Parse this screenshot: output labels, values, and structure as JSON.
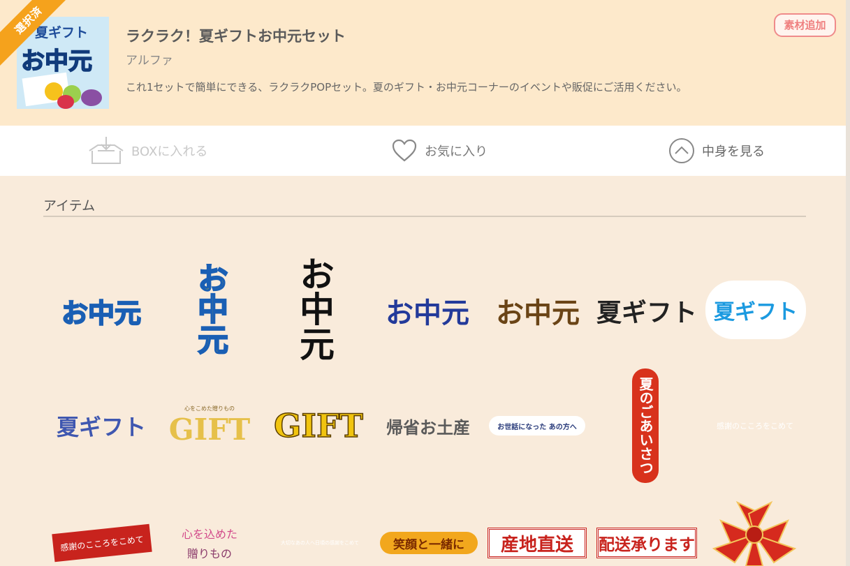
{
  "badge": {
    "label": "選択済"
  },
  "set": {
    "title": "ラクラク！夏ギフトお中元セット",
    "author": "アルファ",
    "description": "これ1セットで簡単にできる、ラクラクPOPセット。夏のギフト・お中元コーナーのイベントや販促にご活用ください。",
    "thumbnail": {
      "line1": "夏ギフト",
      "line2": "お中元"
    }
  },
  "header_button": {
    "label": "素材追加"
  },
  "actions": {
    "box": {
      "label": "BOXに入れる",
      "icon": "box-icon"
    },
    "favorite": {
      "label": "お気に入り",
      "icon": "heart-icon"
    },
    "view": {
      "label": "中身を見る",
      "icon": "chevron-up-icon"
    }
  },
  "section": {
    "title": "アイテム"
  },
  "items": [
    {
      "text": "お中元"
    },
    {
      "text": "お中元"
    },
    {
      "text": "お中元"
    },
    {
      "text": "お中元"
    },
    {
      "text": "お中元"
    },
    {
      "text": "夏ギフト"
    },
    {
      "text": "夏ギフト"
    },
    {
      "text": "夏ギフト"
    },
    {
      "text": "GIFT",
      "sub": "心をこめた贈りもの"
    },
    {
      "text": "GIFT"
    },
    {
      "text": "帰省お土産"
    },
    {
      "text": "お世話になった あの方へ"
    },
    {
      "text": "夏のごあいさつ"
    },
    {
      "text": "感謝のこころをこめて"
    },
    {
      "text": "感謝のこころをこめて"
    },
    {
      "text": "心を込めた",
      "sub": "贈りもの"
    },
    {
      "text": "大切なあの人へ日頃の感謝をこめて"
    },
    {
      "text": "笑顔と一緒に"
    },
    {
      "text": "産地直送"
    },
    {
      "text": "配送承ります"
    },
    {
      "text": ""
    }
  ],
  "colors": {
    "header_bg": "#fde9cb",
    "page_bg": "#f9ebdb",
    "badge": "#f5a21c",
    "accent_pink": "#ef7f7f"
  }
}
